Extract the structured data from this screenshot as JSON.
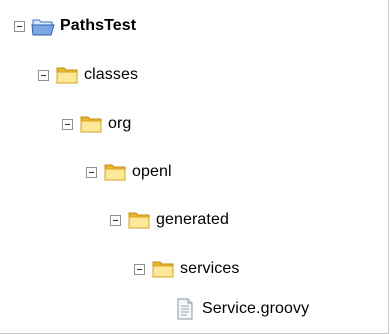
{
  "tree": {
    "root": {
      "label": "PathsTest",
      "icon": "open-folder-icon",
      "expanded": true
    },
    "nodes": [
      {
        "label": "classes",
        "icon": "folder-icon",
        "expanded": true
      },
      {
        "label": "org",
        "icon": "folder-icon",
        "expanded": true
      },
      {
        "label": "openl",
        "icon": "folder-icon",
        "expanded": true
      },
      {
        "label": "generated",
        "icon": "folder-icon",
        "expanded": true
      },
      {
        "label": "services",
        "icon": "folder-icon",
        "expanded": true
      },
      {
        "label": "Service.groovy",
        "icon": "file-icon"
      }
    ]
  },
  "colors": {
    "folder_light": "#fde89a",
    "folder_dark": "#e9b72c",
    "open_folder_blue": "#7aa7e6",
    "file_gray": "#b6bfc8"
  }
}
